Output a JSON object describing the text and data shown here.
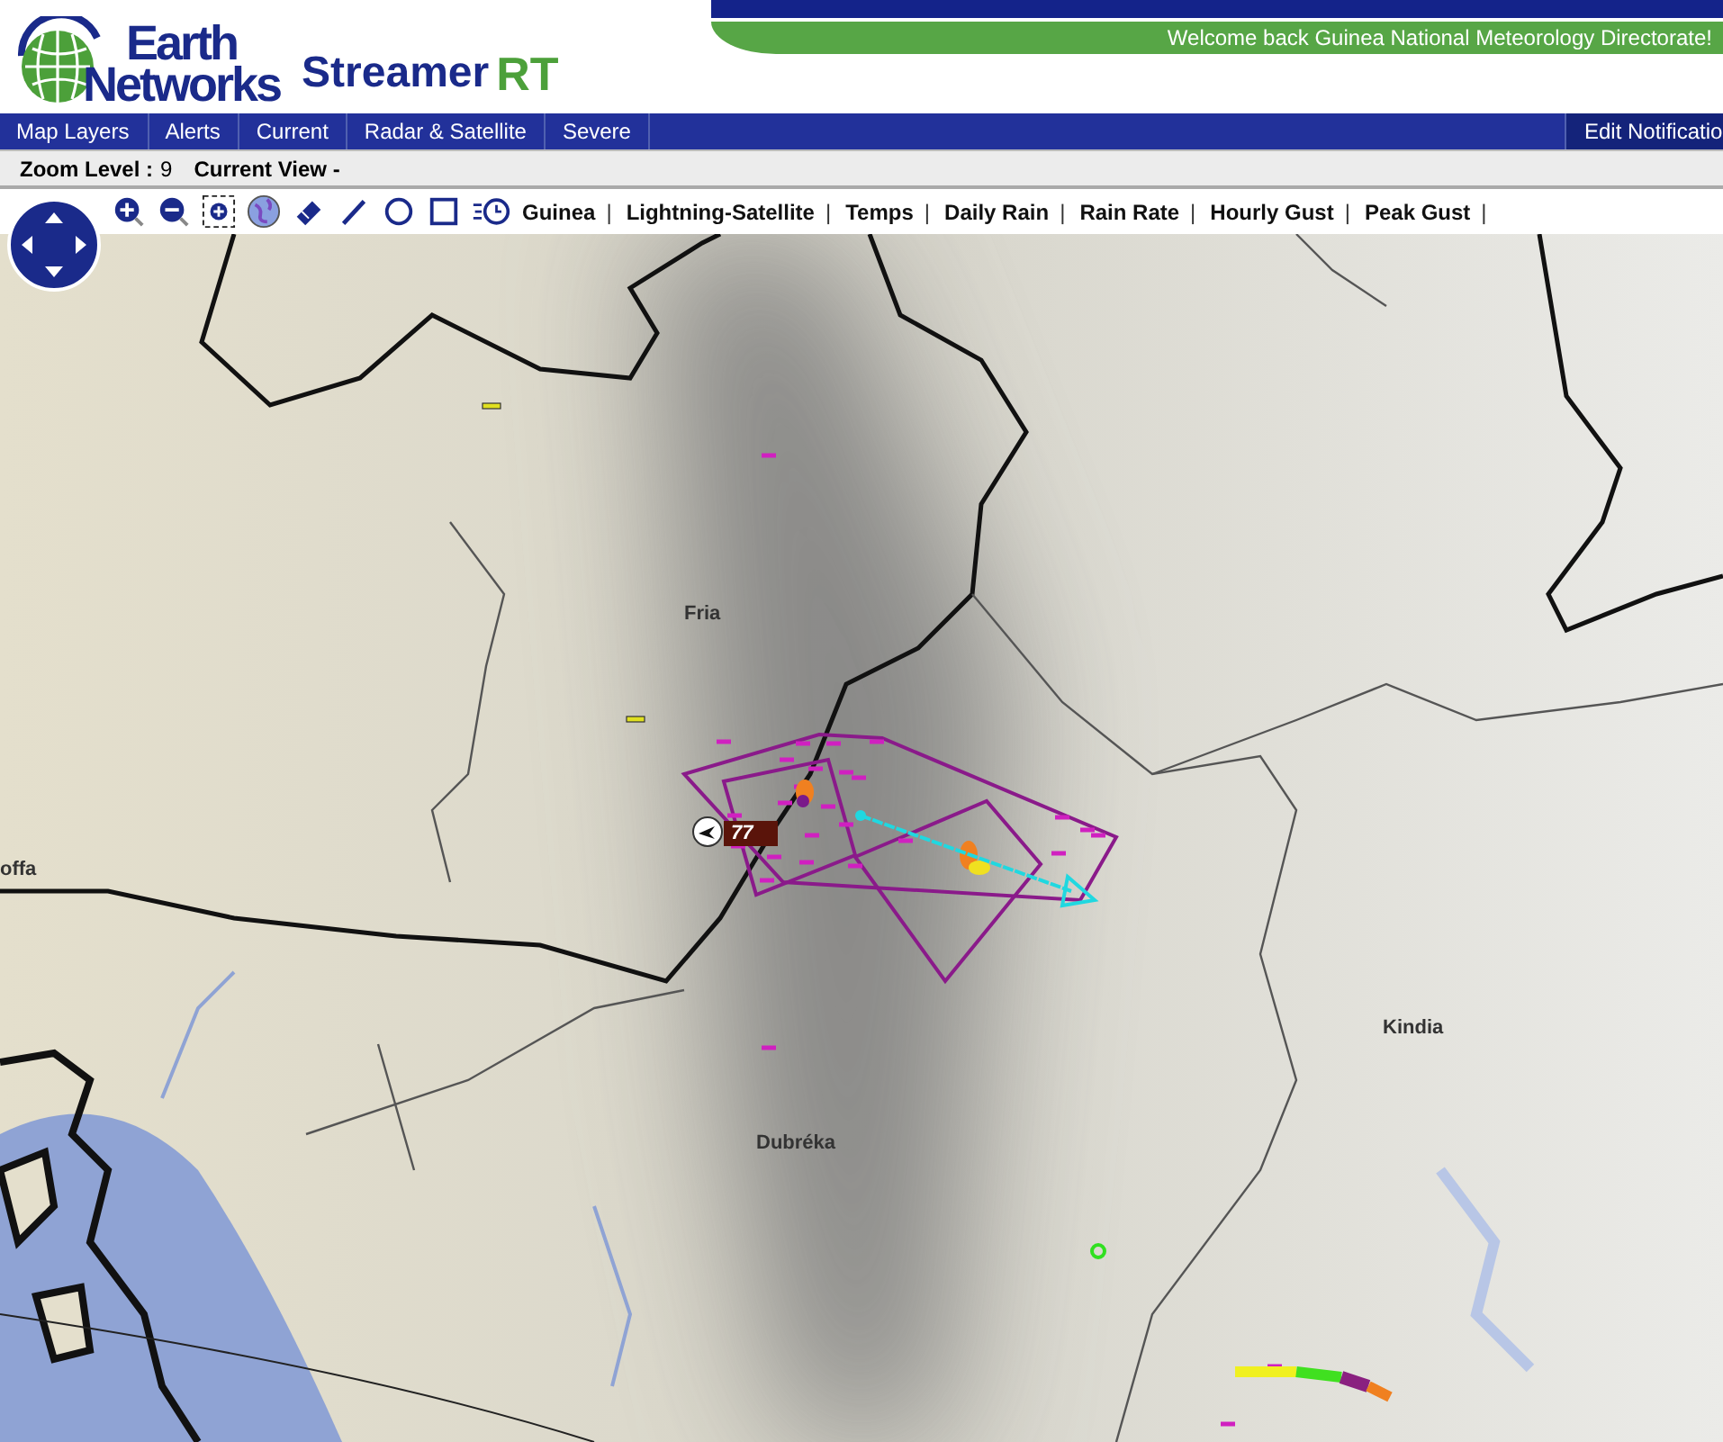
{
  "header": {
    "logo_top": "Earth",
    "logo_bottom": "Networks",
    "product": "Streamer",
    "product_suffix": "RT",
    "welcome": "Welcome back  Guinea National Meteorology Directorate!"
  },
  "nav": {
    "items": [
      {
        "label": "Map Layers"
      },
      {
        "label": "Alerts"
      },
      {
        "label": "Current"
      },
      {
        "label": "Radar & Satellite"
      },
      {
        "label": "Severe"
      }
    ],
    "right_item": "Edit Notificatio"
  },
  "status": {
    "zoom_label": "Zoom Level :",
    "zoom_value": "9",
    "view_label": "Current View -"
  },
  "toolbar": {
    "links": [
      {
        "label": "Guinea",
        "separator": "|"
      },
      {
        "label": "Lightning-Satellite",
        "separator": "|"
      },
      {
        "label": "Temps",
        "separator": "|"
      },
      {
        "label": "Daily Rain",
        "separator": "|"
      },
      {
        "label": "Rain Rate",
        "separator": "|"
      },
      {
        "label": "Hourly Gust",
        "separator": "|"
      },
      {
        "label": "Peak Gust",
        "separator": "|"
      }
    ]
  },
  "map": {
    "places": [
      {
        "name": "Fria"
      },
      {
        "name": "offa"
      },
      {
        "name": "Kindia"
      },
      {
        "name": "Dubréka"
      }
    ],
    "storm_cell": {
      "label": "77"
    }
  }
}
